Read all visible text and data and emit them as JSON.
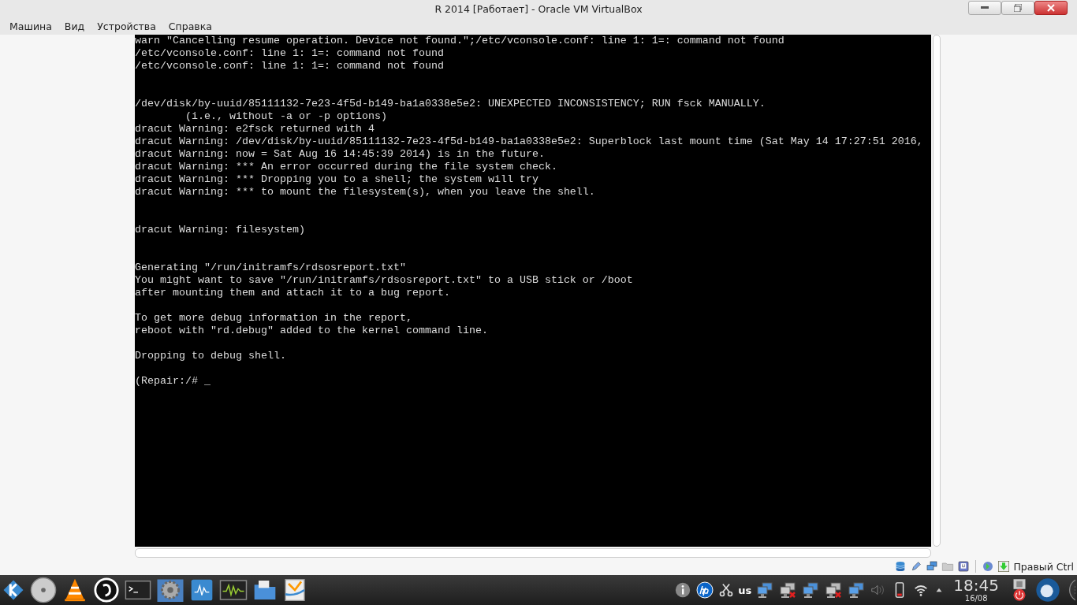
{
  "window": {
    "title": "R 2014 [Работает] - Oracle VM VirtualBox"
  },
  "menu": [
    "Машина",
    "Вид",
    "Устройства",
    "Справка"
  ],
  "console": {
    "blocks": [
      {
        "kind": "first",
        "lines": [
          "warn \"Cancelling resume operation. Device not found.\";/etc/vconsole.conf: line 1: 1=: command not found",
          "/etc/vconsole.conf: line 1: 1=: command not found",
          "/etc/vconsole.conf: line 1: 1=: command not found"
        ]
      },
      {
        "kind": "wide",
        "lines": [
          "/dev/disk/by-uuid/85111132-7e23-4f5d-b149-ba1a0338e5e2: UNEXPECTED INCONSISTENCY; RUN fsck MANUALLY.",
          "        (i.e., without -a or -p options)",
          "dracut Warning: e2fsck returned with 4",
          "dracut Warning: /dev/disk/by-uuid/85111132-7e23-4f5d-b149-ba1a0338e5e2: Superblock last mount time (Sat May 14 17:27:51 2016,",
          "dracut Warning: now = Sat Aug 16 14:45:39 2014) is in the future.",
          "dracut Warning: *** An error occurred during the file system check.",
          "dracut Warning: *** Dropping you to a shell; the system will try",
          "dracut Warning: *** to mount the filesystem(s), when you leave the shell."
        ]
      },
      {
        "kind": "wide",
        "lines": [
          "dracut Warning: filesystem)"
        ]
      },
      {
        "kind": "wide",
        "lines": [
          "Generating \"/run/initramfs/rdsosreport.txt\"",
          "You might want to save \"/run/initramfs/rdsosreport.txt\" to a USB stick or /boot",
          "after mounting them and attach it to a bug report."
        ]
      },
      {
        "kind": "narrow",
        "lines": [
          "To get more debug information in the report,",
          "reboot with \"rd.debug\" added to the kernel command line."
        ]
      },
      {
        "kind": "narrow",
        "lines": [
          "Dropping to debug shell."
        ]
      },
      {
        "kind": "narrow",
        "lines": [
          "(Repair:/# _"
        ]
      }
    ]
  },
  "status_bar": {
    "host_key": "Правый Ctrl"
  },
  "taskbar": {
    "keyboard_layout": "us",
    "time": "18:45",
    "date": "16/08"
  }
}
